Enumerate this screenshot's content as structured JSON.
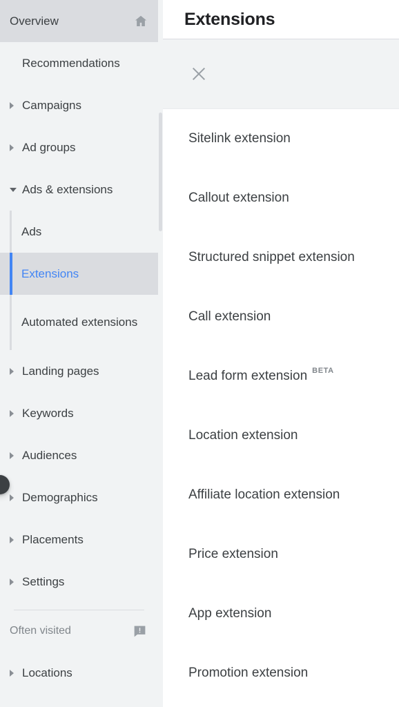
{
  "sidebar": {
    "overview": {
      "label": "Overview",
      "icon": "home-icon"
    },
    "items": [
      {
        "label": "Recommendations",
        "expandable": false,
        "state": "none"
      },
      {
        "label": "Campaigns",
        "expandable": true,
        "state": "collapsed"
      },
      {
        "label": "Ad groups",
        "expandable": true,
        "state": "collapsed"
      },
      {
        "label": "Ads & extensions",
        "expandable": true,
        "state": "expanded"
      }
    ],
    "sub_items": [
      {
        "label": "Ads",
        "active": false
      },
      {
        "label": "Extensions",
        "active": true
      },
      {
        "label": "Automated extensions",
        "active": false
      }
    ],
    "items_after": [
      {
        "label": "Landing pages",
        "expandable": true,
        "state": "collapsed"
      },
      {
        "label": "Keywords",
        "expandable": true,
        "state": "collapsed"
      },
      {
        "label": "Audiences",
        "expandable": true,
        "state": "collapsed"
      },
      {
        "label": "Demographics",
        "expandable": true,
        "state": "collapsed"
      },
      {
        "label": "Placements",
        "expandable": true,
        "state": "collapsed"
      },
      {
        "label": "Settings",
        "expandable": true,
        "state": "collapsed"
      }
    ],
    "often_visited": {
      "label": "Often visited",
      "icon": "feedback-icon"
    },
    "often_items": [
      {
        "label": "Locations",
        "expandable": true,
        "state": "collapsed"
      }
    ],
    "collapse_handle": {
      "name": "collapse-sidebar-handle"
    },
    "colors": {
      "background": "#f1f3f4",
      "selected_background": "#dadce0",
      "accent": "#4285f4",
      "text": "#3c4043",
      "muted_text": "#80868b",
      "rail": "#dadce0"
    }
  },
  "main": {
    "header": {
      "title": "Extensions"
    },
    "panel": {
      "close_label": "",
      "close_icon": "close-icon"
    },
    "extensions": [
      {
        "label": "Sitelink extension",
        "badge": ""
      },
      {
        "label": "Callout extension",
        "badge": ""
      },
      {
        "label": "Structured snippet extension",
        "badge": ""
      },
      {
        "label": "Call extension",
        "badge": ""
      },
      {
        "label": "Lead form extension",
        "badge": "BETA"
      },
      {
        "label": "Location extension",
        "badge": ""
      },
      {
        "label": "Affiliate location extension",
        "badge": ""
      },
      {
        "label": "Price extension",
        "badge": ""
      },
      {
        "label": "App extension",
        "badge": ""
      },
      {
        "label": "Promotion extension",
        "badge": ""
      }
    ]
  },
  "scrollbar": {
    "name": "vertical-scrollbar",
    "thumb_color": "#dadce0"
  }
}
